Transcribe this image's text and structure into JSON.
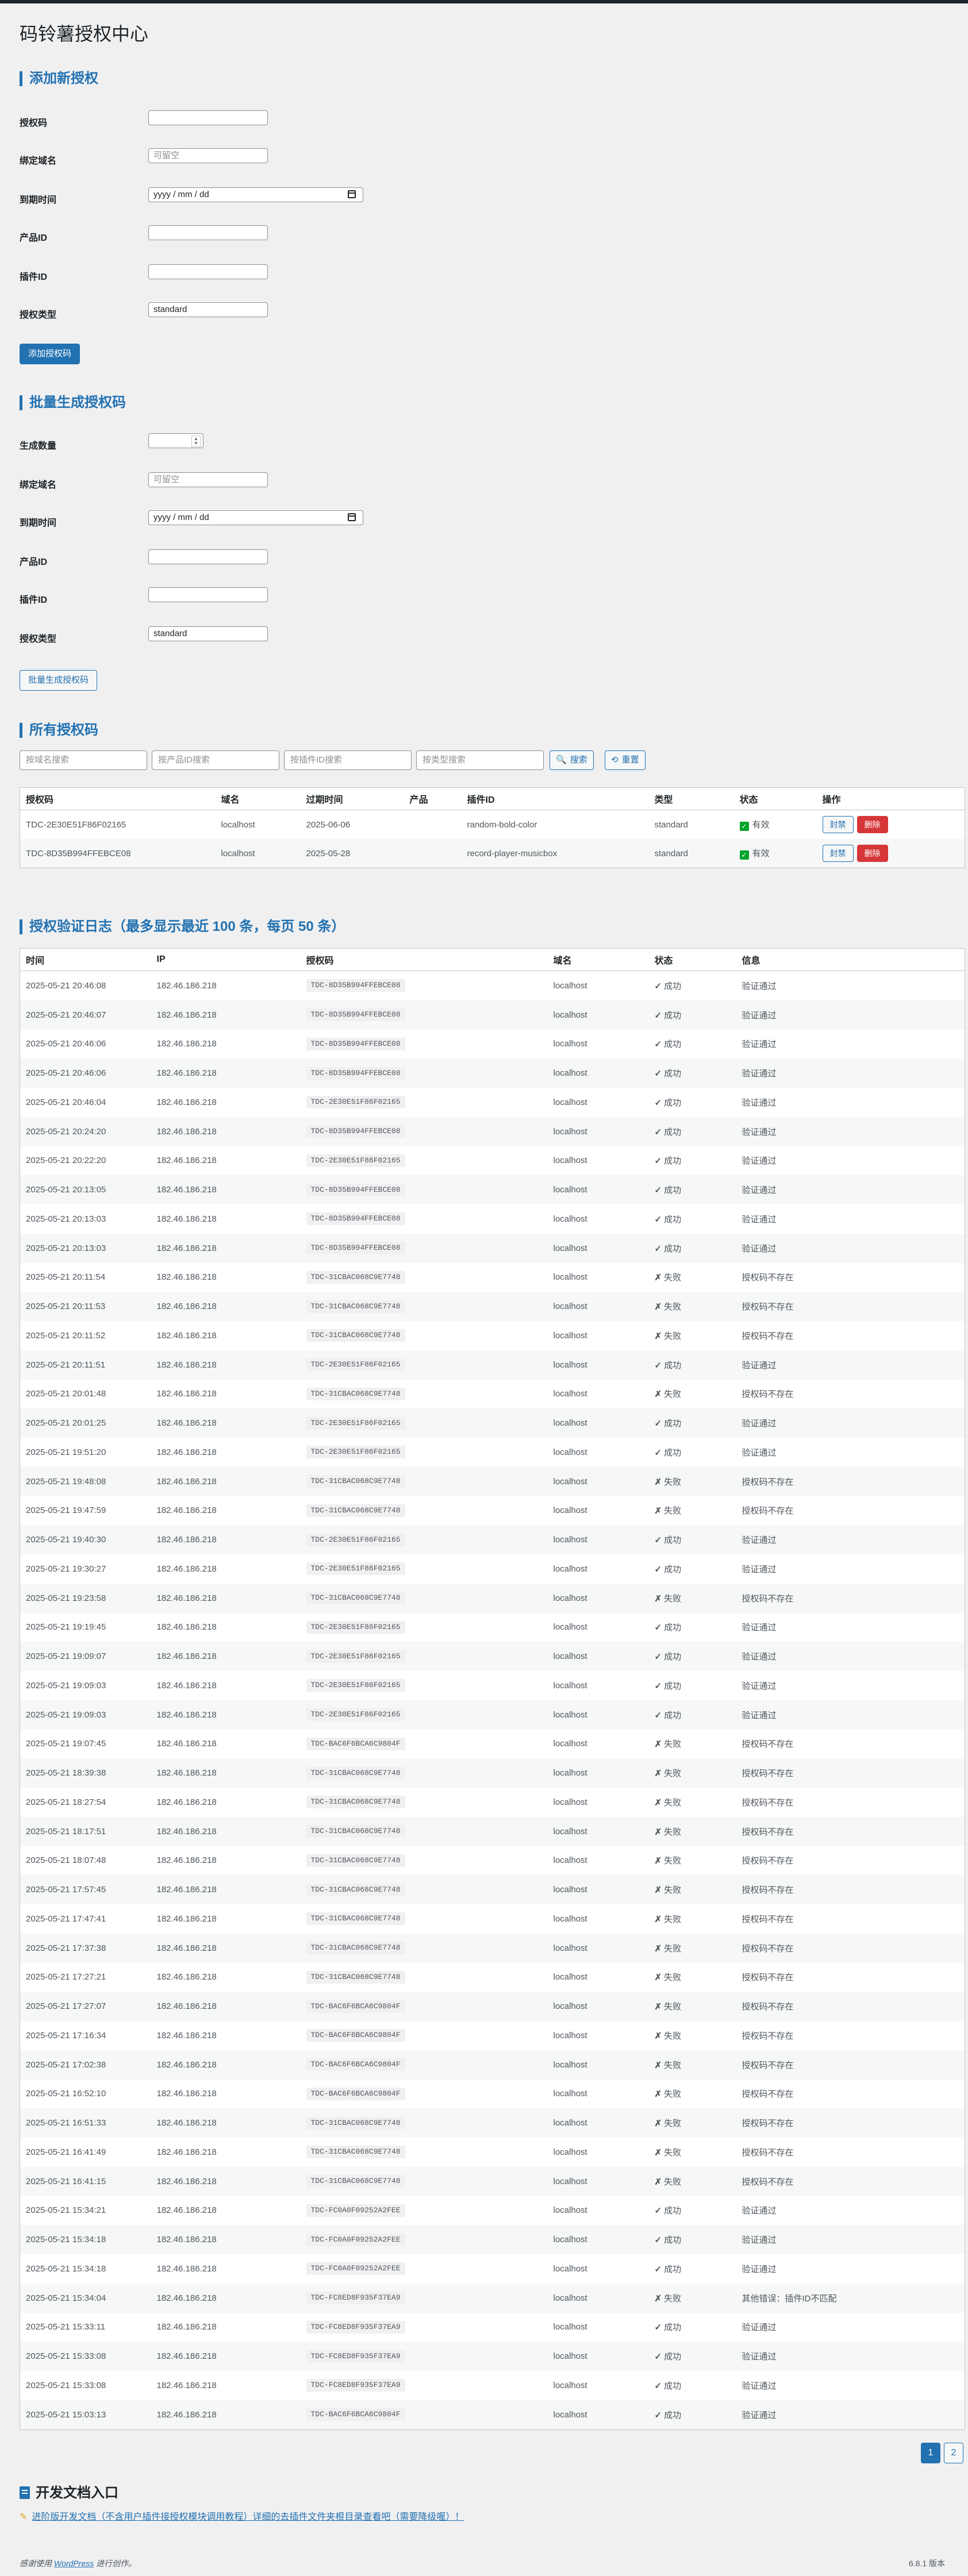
{
  "page": {
    "title": "码铃薯授权中心"
  },
  "add_section": {
    "title": "添加新授权",
    "fields": {
      "code_label": "授权码",
      "domain_label": "绑定域名",
      "domain_placeholder": "可留空",
      "expire_label": "到期时间",
      "expire_placeholder": "yyyy / mm / dd",
      "product_label": "产品ID",
      "plugin_label": "插件ID",
      "type_label": "授权类型",
      "type_value": "standard"
    },
    "submit": "添加授权码"
  },
  "batch_section": {
    "title": "批量生成授权码",
    "fields": {
      "count_label": "生成数量",
      "domain_label": "绑定域名",
      "domain_placeholder": "可留空",
      "expire_label": "到期时间",
      "expire_placeholder": "yyyy / mm / dd",
      "product_label": "产品ID",
      "plugin_label": "插件ID",
      "type_label": "授权类型",
      "type_value": "standard"
    },
    "submit": "批量生成授权码"
  },
  "all_section": {
    "title": "所有授权码",
    "search": {
      "domain_placeholder": "按域名搜索",
      "product_placeholder": "按产品ID搜索",
      "plugin_placeholder": "按插件ID搜索",
      "type_placeholder": "按类型搜索",
      "search_btn": "搜索",
      "reset_btn": "重置"
    },
    "columns": [
      "授权码",
      "域名",
      "过期时间",
      "产品",
      "插件ID",
      "类型",
      "状态",
      "操作"
    ],
    "rows": [
      {
        "code": "TDC-2E30E51F86F02165",
        "domain": "localhost",
        "expire": "2025-06-06",
        "product": "",
        "plugin": "random-bold-color",
        "type": "standard",
        "status": "有效",
        "ban": "封禁",
        "del": "删除"
      },
      {
        "code": "TDC-8D35B994FFEBCE08",
        "domain": "localhost",
        "expire": "2025-05-28",
        "product": "",
        "plugin": "record-player-musicbox",
        "type": "standard",
        "status": "有效",
        "ban": "封禁",
        "del": "删除"
      }
    ]
  },
  "log_section": {
    "title": "授权验证日志（最多显示最近 100 条，每页 50 条）",
    "columns": [
      "时间",
      "IP",
      "授权码",
      "域名",
      "状态",
      "信息"
    ],
    "ok_label": "成功",
    "fail_label": "失败",
    "rows": [
      {
        "time": "2025-05-21 20:46:08",
        "ip": "182.46.186.218",
        "code": "TDC-8D35B994FFEBCE08",
        "domain": "localhost",
        "ok": true,
        "msg": "验证通过"
      },
      {
        "time": "2025-05-21 20:46:07",
        "ip": "182.46.186.218",
        "code": "TDC-8D35B994FFEBCE08",
        "domain": "localhost",
        "ok": true,
        "msg": "验证通过"
      },
      {
        "time": "2025-05-21 20:46:06",
        "ip": "182.46.186.218",
        "code": "TDC-8D35B994FFEBCE08",
        "domain": "localhost",
        "ok": true,
        "msg": "验证通过"
      },
      {
        "time": "2025-05-21 20:46:06",
        "ip": "182.46.186.218",
        "code": "TDC-8D35B994FFEBCE08",
        "domain": "localhost",
        "ok": true,
        "msg": "验证通过"
      },
      {
        "time": "2025-05-21 20:46:04",
        "ip": "182.46.186.218",
        "code": "TDC-2E30E51F86F02165",
        "domain": "localhost",
        "ok": true,
        "msg": "验证通过"
      },
      {
        "time": "2025-05-21 20:24:20",
        "ip": "182.46.186.218",
        "code": "TDC-8D35B994FFEBCE08",
        "domain": "localhost",
        "ok": true,
        "msg": "验证通过"
      },
      {
        "time": "2025-05-21 20:22:20",
        "ip": "182.46.186.218",
        "code": "TDC-2E30E51F86F02165",
        "domain": "localhost",
        "ok": true,
        "msg": "验证通过"
      },
      {
        "time": "2025-05-21 20:13:05",
        "ip": "182.46.186.218",
        "code": "TDC-8D35B994FFEBCE08",
        "domain": "localhost",
        "ok": true,
        "msg": "验证通过"
      },
      {
        "time": "2025-05-21 20:13:03",
        "ip": "182.46.186.218",
        "code": "TDC-8D35B994FFEBCE08",
        "domain": "localhost",
        "ok": true,
        "msg": "验证通过"
      },
      {
        "time": "2025-05-21 20:13:03",
        "ip": "182.46.186.218",
        "code": "TDC-8D35B994FFEBCE08",
        "domain": "localhost",
        "ok": true,
        "msg": "验证通过"
      },
      {
        "time": "2025-05-21 20:11:54",
        "ip": "182.46.186.218",
        "code": "TDC-31CBAC068C9E7748",
        "domain": "localhost",
        "ok": false,
        "msg": "授权码不存在"
      },
      {
        "time": "2025-05-21 20:11:53",
        "ip": "182.46.186.218",
        "code": "TDC-31CBAC068C9E7748",
        "domain": "localhost",
        "ok": false,
        "msg": "授权码不存在"
      },
      {
        "time": "2025-05-21 20:11:52",
        "ip": "182.46.186.218",
        "code": "TDC-31CBAC068C9E7748",
        "domain": "localhost",
        "ok": false,
        "msg": "授权码不存在"
      },
      {
        "time": "2025-05-21 20:11:51",
        "ip": "182.46.186.218",
        "code": "TDC-2E30E51F86F02165",
        "domain": "localhost",
        "ok": true,
        "msg": "验证通过"
      },
      {
        "time": "2025-05-21 20:01:48",
        "ip": "182.46.186.218",
        "code": "TDC-31CBAC068C9E7748",
        "domain": "localhost",
        "ok": false,
        "msg": "授权码不存在"
      },
      {
        "time": "2025-05-21 20:01:25",
        "ip": "182.46.186.218",
        "code": "TDC-2E30E51F86F02165",
        "domain": "localhost",
        "ok": true,
        "msg": "验证通过"
      },
      {
        "time": "2025-05-21 19:51:20",
        "ip": "182.46.186.218",
        "code": "TDC-2E30E51F86F02165",
        "domain": "localhost",
        "ok": true,
        "msg": "验证通过"
      },
      {
        "time": "2025-05-21 19:48:08",
        "ip": "182.46.186.218",
        "code": "TDC-31CBAC068C9E7748",
        "domain": "localhost",
        "ok": false,
        "msg": "授权码不存在"
      },
      {
        "time": "2025-05-21 19:47:59",
        "ip": "182.46.186.218",
        "code": "TDC-31CBAC068C9E7748",
        "domain": "localhost",
        "ok": false,
        "msg": "授权码不存在"
      },
      {
        "time": "2025-05-21 19:40:30",
        "ip": "182.46.186.218",
        "code": "TDC-2E30E51F86F02165",
        "domain": "localhost",
        "ok": true,
        "msg": "验证通过"
      },
      {
        "time": "2025-05-21 19:30:27",
        "ip": "182.46.186.218",
        "code": "TDC-2E30E51F86F02165",
        "domain": "localhost",
        "ok": true,
        "msg": "验证通过"
      },
      {
        "time": "2025-05-21 19:23:58",
        "ip": "182.46.186.218",
        "code": "TDC-31CBAC068C9E7748",
        "domain": "localhost",
        "ok": false,
        "msg": "授权码不存在"
      },
      {
        "time": "2025-05-21 19:19:45",
        "ip": "182.46.186.218",
        "code": "TDC-2E30E51F86F02165",
        "domain": "localhost",
        "ok": true,
        "msg": "验证通过"
      },
      {
        "time": "2025-05-21 19:09:07",
        "ip": "182.46.186.218",
        "code": "TDC-2E30E51F86F02165",
        "domain": "localhost",
        "ok": true,
        "msg": "验证通过"
      },
      {
        "time": "2025-05-21 19:09:03",
        "ip": "182.46.186.218",
        "code": "TDC-2E30E51F86F02165",
        "domain": "localhost",
        "ok": true,
        "msg": "验证通过"
      },
      {
        "time": "2025-05-21 19:09:03",
        "ip": "182.46.186.218",
        "code": "TDC-2E30E51F86F02165",
        "domain": "localhost",
        "ok": true,
        "msg": "验证通过"
      },
      {
        "time": "2025-05-21 19:07:45",
        "ip": "182.46.186.218",
        "code": "TDC-BAC6F6BCA6C9804F",
        "domain": "localhost",
        "ok": false,
        "msg": "授权码不存在"
      },
      {
        "time": "2025-05-21 18:39:38",
        "ip": "182.46.186.218",
        "code": "TDC-31CBAC068C9E7748",
        "domain": "localhost",
        "ok": false,
        "msg": "授权码不存在"
      },
      {
        "time": "2025-05-21 18:27:54",
        "ip": "182.46.186.218",
        "code": "TDC-31CBAC068C9E7748",
        "domain": "localhost",
        "ok": false,
        "msg": "授权码不存在"
      },
      {
        "time": "2025-05-21 18:17:51",
        "ip": "182.46.186.218",
        "code": "TDC-31CBAC068C9E7748",
        "domain": "localhost",
        "ok": false,
        "msg": "授权码不存在"
      },
      {
        "time": "2025-05-21 18:07:48",
        "ip": "182.46.186.218",
        "code": "TDC-31CBAC068C9E7748",
        "domain": "localhost",
        "ok": false,
        "msg": "授权码不存在"
      },
      {
        "time": "2025-05-21 17:57:45",
        "ip": "182.46.186.218",
        "code": "TDC-31CBAC068C9E7748",
        "domain": "localhost",
        "ok": false,
        "msg": "授权码不存在"
      },
      {
        "time": "2025-05-21 17:47:41",
        "ip": "182.46.186.218",
        "code": "TDC-31CBAC068C9E7748",
        "domain": "localhost",
        "ok": false,
        "msg": "授权码不存在"
      },
      {
        "time": "2025-05-21 17:37:38",
        "ip": "182.46.186.218",
        "code": "TDC-31CBAC068C9E7748",
        "domain": "localhost",
        "ok": false,
        "msg": "授权码不存在"
      },
      {
        "time": "2025-05-21 17:27:21",
        "ip": "182.46.186.218",
        "code": "TDC-31CBAC068C9E7748",
        "domain": "localhost",
        "ok": false,
        "msg": "授权码不存在"
      },
      {
        "time": "2025-05-21 17:27:07",
        "ip": "182.46.186.218",
        "code": "TDC-BAC6F6BCA6C9804F",
        "domain": "localhost",
        "ok": false,
        "msg": "授权码不存在"
      },
      {
        "time": "2025-05-21 17:16:34",
        "ip": "182.46.186.218",
        "code": "TDC-BAC6F6BCA6C9804F",
        "domain": "localhost",
        "ok": false,
        "msg": "授权码不存在"
      },
      {
        "time": "2025-05-21 17:02:38",
        "ip": "182.46.186.218",
        "code": "TDC-BAC6F6BCA6C9804F",
        "domain": "localhost",
        "ok": false,
        "msg": "授权码不存在"
      },
      {
        "time": "2025-05-21 16:52:10",
        "ip": "182.46.186.218",
        "code": "TDC-BAC6F6BCA6C9804F",
        "domain": "localhost",
        "ok": false,
        "msg": "授权码不存在"
      },
      {
        "time": "2025-05-21 16:51:33",
        "ip": "182.46.186.218",
        "code": "TDC-31CBAC068C9E7748",
        "domain": "localhost",
        "ok": false,
        "msg": "授权码不存在"
      },
      {
        "time": "2025-05-21 16:41:49",
        "ip": "182.46.186.218",
        "code": "TDC-31CBAC068C9E7748",
        "domain": "localhost",
        "ok": false,
        "msg": "授权码不存在"
      },
      {
        "time": "2025-05-21 16:41:15",
        "ip": "182.46.186.218",
        "code": "TDC-31CBAC068C9E7748",
        "domain": "localhost",
        "ok": false,
        "msg": "授权码不存在"
      },
      {
        "time": "2025-05-21 15:34:21",
        "ip": "182.46.186.218",
        "code": "TDC-FC0A0F09252A2FEE",
        "domain": "localhost",
        "ok": true,
        "msg": "验证通过"
      },
      {
        "time": "2025-05-21 15:34:18",
        "ip": "182.46.186.218",
        "code": "TDC-FC0A0F09252A2FEE",
        "domain": "localhost",
        "ok": true,
        "msg": "验证通过"
      },
      {
        "time": "2025-05-21 15:34:18",
        "ip": "182.46.186.218",
        "code": "TDC-FC0A0F09252A2FEE",
        "domain": "localhost",
        "ok": true,
        "msg": "验证通过"
      },
      {
        "time": "2025-05-21 15:34:04",
        "ip": "182.46.186.218",
        "code": "TDC-FC8ED8F935F37EA9",
        "domain": "localhost",
        "ok": false,
        "msg": "其他错误：插件ID不匹配"
      },
      {
        "time": "2025-05-21 15:33:11",
        "ip": "182.46.186.218",
        "code": "TDC-FC8ED8F935F37EA9",
        "domain": "localhost",
        "ok": true,
        "msg": "验证通过"
      },
      {
        "time": "2025-05-21 15:33:08",
        "ip": "182.46.186.218",
        "code": "TDC-FC8ED8F935F37EA9",
        "domain": "localhost",
        "ok": true,
        "msg": "验证通过"
      },
      {
        "time": "2025-05-21 15:33:08",
        "ip": "182.46.186.218",
        "code": "TDC-FC8ED8F935F37EA9",
        "domain": "localhost",
        "ok": true,
        "msg": "验证通过"
      },
      {
        "time": "2025-05-21 15:03:13",
        "ip": "182.46.186.218",
        "code": "TDC-BAC6F6BCA6C9804F",
        "domain": "localhost",
        "ok": true,
        "msg": "验证通过"
      }
    ]
  },
  "pagination": {
    "pages": [
      "1",
      "2"
    ],
    "current": "1"
  },
  "dev_section": {
    "title": "开发文档入口",
    "link_text": "进阶版开发文档（不含用户插件接授权模块调用教程）详细的去插件文件夹根目录查看吧（需要降级喔）！"
  },
  "footer": {
    "thanks_prefix": "感谢使用",
    "thanks_link": "WordPress",
    "thanks_suffix": "进行创作。",
    "version": "6.8.1 版本"
  }
}
